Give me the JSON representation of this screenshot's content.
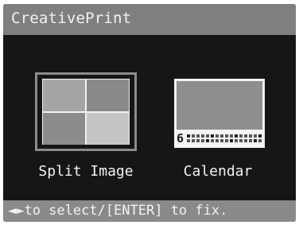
{
  "header": {
    "title": "CreativePrint"
  },
  "options": [
    {
      "label": "Split Image",
      "selected": true
    },
    {
      "label": "Calendar",
      "selected": false,
      "thumbnail_month": "6"
    }
  ],
  "footer": {
    "hint": "◄►to select/[ENTER] to fix."
  },
  "colors": {
    "background": "#161616",
    "title_bar": "#7f7f7f",
    "hint_bar": "#8a8a8a",
    "text": "#f2f2f2",
    "selection_frame": "#8c8c8c"
  }
}
